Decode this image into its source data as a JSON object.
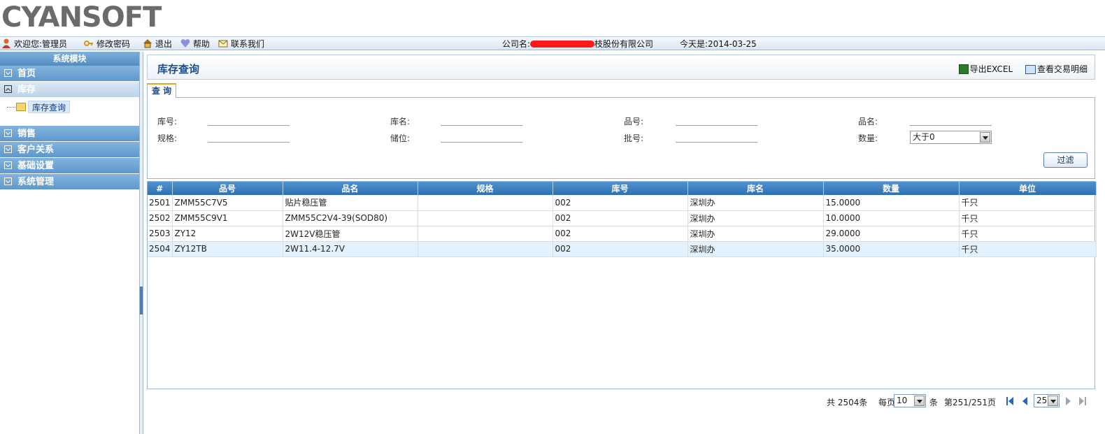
{
  "brand": {
    "logo_text": "CYANSOFT"
  },
  "topbar": {
    "welcome": "欢迎您:管理员",
    "change_password": "修改密码",
    "logout": "退出",
    "help": "帮助",
    "contact": "联系我们",
    "company_prefix": "公司名:",
    "company_suffix": "枝股份有限公司",
    "today": "今天是:2014-03-25"
  },
  "sidebar": {
    "header": "系统模块",
    "menus": [
      "首页",
      "库存",
      "销售",
      "客户关系",
      "基础设置",
      "系统管理"
    ],
    "sub_item": "库存查询"
  },
  "main": {
    "title": "库存查询",
    "actions": {
      "export": "导出EXCEL",
      "details": "查看交易明细"
    },
    "tab": "查 询",
    "form": {
      "warehouse_no": "库号:",
      "warehouse_name": "库名:",
      "item_no": "品号:",
      "item_name": "品名:",
      "spec": "规格:",
      "location": "储位:",
      "batch": "批号:",
      "quantity": "数量:",
      "quantity_value": "大于0",
      "filter_button": "过滤"
    },
    "table": {
      "headers": [
        "#",
        "品号",
        "品名",
        "规格",
        "库号",
        "库名",
        "数量",
        "单位"
      ],
      "rows": [
        [
          "2501",
          "ZMM55C7V5",
          "贴片稳压管",
          "",
          "002",
          "深圳办",
          "15.0000",
          "千只"
        ],
        [
          "2502",
          "ZMM55C9V1",
          "ZMM55C2V4-39(SOD80)",
          "",
          "002",
          "深圳办",
          "10.0000",
          "千只"
        ],
        [
          "2503",
          "ZY12",
          "2W12V稳压管",
          "",
          "002",
          "深圳办",
          "29.0000",
          "千只"
        ],
        [
          "2504",
          "ZY12TB",
          "2W11.4-12.7V",
          "",
          "002",
          "深圳办",
          "35.0000",
          "千只"
        ]
      ]
    },
    "pager": {
      "total_prefix": "共",
      "total": "2504",
      "total_suffix": "条",
      "per_page_label": "每页",
      "per_page": "10",
      "per_page_suffix": "条",
      "page_prefix": "第",
      "page": "251/251",
      "page_suffix": "页",
      "jump": "25"
    }
  },
  "colors": {
    "accent": "#1e4c86",
    "header_blue": "#2f6fb0",
    "menu_blue": "#5e98cc",
    "tab_orange": "#e6a42c"
  }
}
